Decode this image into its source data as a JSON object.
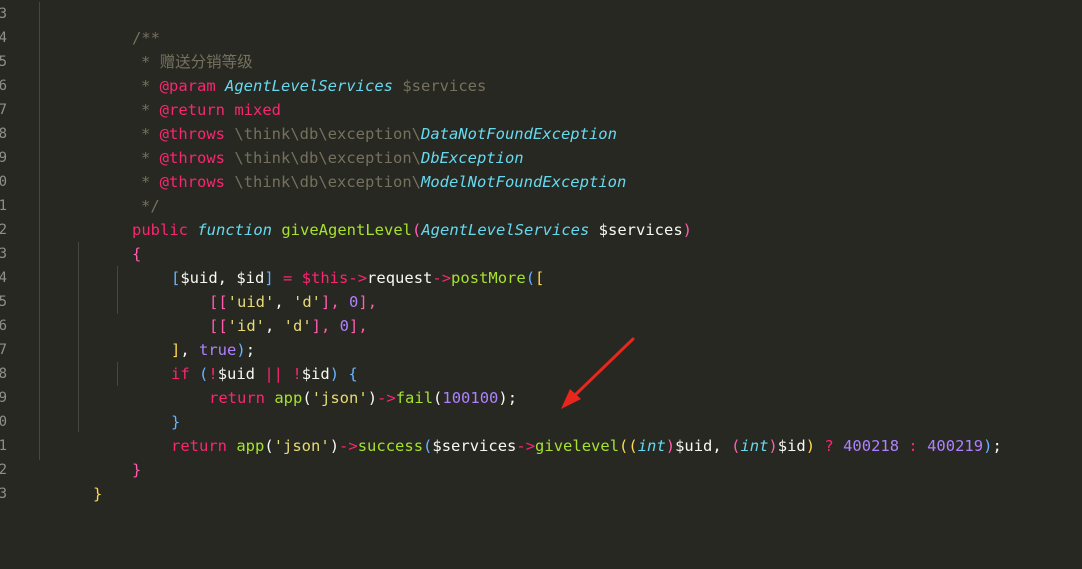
{
  "gutter": {
    "line_numbers": [
      "3",
      "4",
      "5",
      "6",
      "7",
      "8",
      "9",
      "0",
      "1",
      "2",
      "3",
      "4",
      "5",
      "6",
      "7",
      "8",
      "9",
      "0",
      "1",
      "2",
      "3"
    ]
  },
  "code": {
    "l1": "/**",
    "l2_star": "* ",
    "l2_text": "赠送分销等级",
    "l3_star": "* ",
    "l3_tag": "@param",
    "l3_type": "AgentLevelServices",
    "l3_var": "$services",
    "l4_star": "* ",
    "l4_tag": "@return",
    "l4_type": "mixed",
    "l5_star": "* ",
    "l5_tag": "@throws",
    "l5_ns": "\\think\\db\\exception\\",
    "l5_class": "DataNotFoundException",
    "l6_star": "* ",
    "l6_tag": "@throws",
    "l6_ns": "\\think\\db\\exception\\",
    "l6_class": "DbException",
    "l7_star": "* ",
    "l7_tag": "@throws",
    "l7_ns": "\\think\\db\\exception\\",
    "l7_class": "ModelNotFoundException",
    "l8": "*/",
    "l9_public": "public",
    "l9_function": "function",
    "l9_name": "giveAgentLevel",
    "l9_open": "(",
    "l9_type": "AgentLevelServices",
    "l9_var": "$services",
    "l9_close": ")",
    "l10": "{",
    "l11_open": "[",
    "l11_uid": "$uid",
    "l11_comma": ", ",
    "l11_id": "$id",
    "l11_close": "]",
    "l11_eq": " = ",
    "l11_this": "$this",
    "l11_arrow1": "->",
    "l11_request": "request",
    "l11_arrow2": "->",
    "l11_postmore": "postMore",
    "l11_paren": "(",
    "l11_br": "[",
    "l12_open": "[[",
    "l12_s1": "'uid'",
    "l12_c1": ", ",
    "l12_s2": "'d'",
    "l12_b": "], ",
    "l12_n": "0",
    "l12_end": "],",
    "l13_open": "[[",
    "l13_s1": "'id'",
    "l13_c1": ", ",
    "l13_s2": "'d'",
    "l13_b": "], ",
    "l13_n": "0",
    "l13_end": "],",
    "l14_close": "]",
    "l14_comma": ", ",
    "l14_true": "true",
    "l14_paren": ")",
    "l14_semi": ";",
    "l15_if": "if",
    "l15_open": " (",
    "l15_not1": "!",
    "l15_uid": "$uid",
    "l15_or": " || ",
    "l15_not2": "!",
    "l15_id": "$id",
    "l15_close": ")",
    "l15_brace": " {",
    "l16_return": "return",
    "l16_app": "app",
    "l16_open": "(",
    "l16_str": "'json'",
    "l16_close": ")",
    "l16_arrow": "->",
    "l16_fail": "fail",
    "l16_open2": "(",
    "l16_num": "100100",
    "l16_close2": ")",
    "l16_semi": ";",
    "l17": "}",
    "l18_return": "return",
    "l18_app": "app",
    "l18_open": "(",
    "l18_str": "'json'",
    "l18_close": ")",
    "l18_arrow": "->",
    "l18_success": "success",
    "l18_open2": "(",
    "l18_services": "$services",
    "l18_arrow2": "->",
    "l18_givelevel": "givelevel",
    "l18_open3": "((",
    "l18_int1": "int",
    "l18_c1": ")",
    "l18_uid": "$uid",
    "l18_comma": ", ",
    "l18_open4": "(",
    "l18_int2": "int",
    "l18_c2": ")",
    "l18_id": "$id",
    "l18_c3": ")",
    "l18_q": " ? ",
    "l18_n1": "400218",
    "l18_colon": " : ",
    "l18_n2": "400219",
    "l18_c4": ")",
    "l18_semi": ";",
    "l19": "}",
    "l20": "}"
  },
  "colors": {
    "background": "#272822",
    "annotation_arrow": "#e8261b"
  }
}
